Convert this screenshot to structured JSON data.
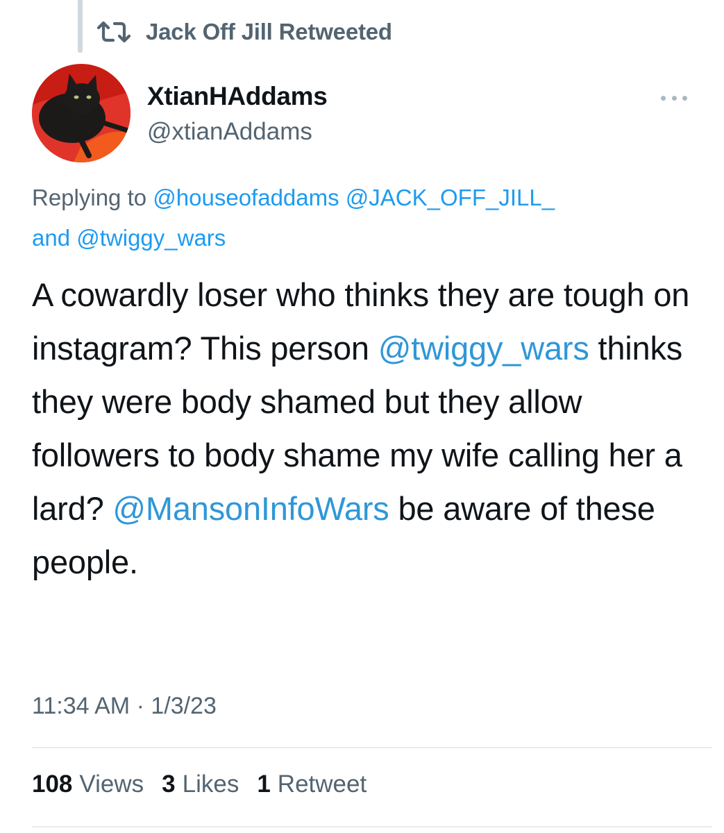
{
  "retweet_header": {
    "label": "Jack Off Jill Retweeted",
    "icon": "retweet-icon"
  },
  "author": {
    "display_name": "XtianHAddams",
    "handle": "@xtianAddams",
    "avatar": "black-cat-avatar"
  },
  "reply_context": {
    "prefix": "Replying to",
    "mention_1": "@houseofaddams",
    "mention_2": "@JACK_OFF_JILL_",
    "and": "and",
    "mention_3": "@twiggy_wars"
  },
  "tweet": {
    "part_1": "A cowardly loser who thinks they are tough on instagram? This person",
    "mention_1": "@twiggy_wars",
    "part_2": "thinks they were body shamed but they allow followers to body shame my wife calling her a lard?",
    "mention_2": "@MansonInfoWars",
    "part_3": "be aware of these people."
  },
  "timestamp": "11:34 AM · 1/3/23",
  "stats": {
    "views_count": "108",
    "views_label": "Views",
    "likes_count": "3",
    "likes_label": "Likes",
    "retweets_count": "1",
    "retweets_label": "Retweet"
  },
  "colors": {
    "link": "#1d9bf0",
    "secondary_text": "#536471",
    "primary_text": "#0f1419"
  }
}
